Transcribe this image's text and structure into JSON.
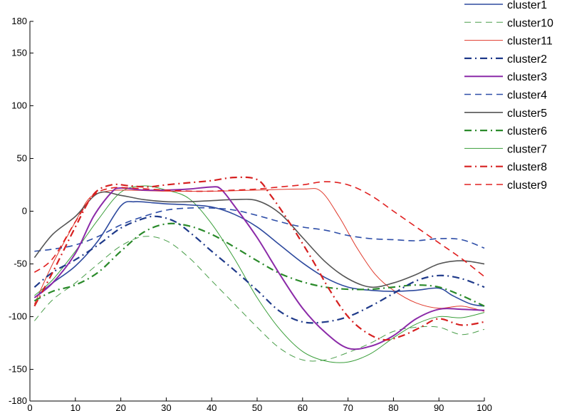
{
  "chart_data": {
    "type": "line",
    "title": "",
    "xlabel": "",
    "ylabel": "",
    "xlim": [
      0,
      100
    ],
    "ylim": [
      -180,
      180
    ],
    "x_ticks": [
      0,
      10,
      20,
      30,
      40,
      50,
      60,
      70,
      80,
      90,
      100
    ],
    "y_ticks": [
      180,
      150,
      100,
      50,
      0,
      -50,
      -100,
      -150,
      -180
    ],
    "grid": false,
    "legend_position": "top-right",
    "series": [
      {
        "name": "cluster1",
        "color": "#2e4a9e",
        "style": "solid",
        "width": 1.6,
        "x": [
          1,
          5,
          10,
          15,
          20,
          23,
          27,
          30,
          35,
          40,
          45,
          50,
          55,
          60,
          65,
          70,
          75,
          80,
          85,
          90,
          93,
          97,
          100
        ],
        "y": [
          -82,
          -68,
          -52,
          -28,
          5,
          9,
          8,
          7,
          6,
          4,
          -3,
          -15,
          -32,
          -49,
          -63,
          -72,
          -75,
          -76,
          -75,
          -73,
          -80,
          -88,
          -90
        ]
      },
      {
        "name": "cluster10",
        "color": "#4a9e4a",
        "style": "dashed",
        "width": 1.0,
        "x": [
          1,
          5,
          10,
          15,
          20,
          25,
          30,
          35,
          40,
          45,
          50,
          55,
          60,
          65,
          70,
          75,
          80,
          85,
          90,
          95,
          100
        ],
        "y": [
          -104,
          -84,
          -68,
          -50,
          -33,
          -24,
          -28,
          -44,
          -66,
          -88,
          -110,
          -130,
          -141,
          -141,
          -134,
          -125,
          -114,
          -110,
          -110,
          -117,
          -112
        ]
      },
      {
        "name": "cluster11",
        "color": "#e0392b",
        "style": "solid",
        "width": 1.0,
        "x": [
          1,
          5,
          10,
          13,
          16,
          20,
          30,
          40,
          50,
          60,
          64,
          68,
          72,
          76,
          80,
          85,
          90,
          95,
          100
        ],
        "y": [
          -88,
          -50,
          -10,
          12,
          18,
          20,
          19,
          19,
          20,
          21,
          19,
          -5,
          -35,
          -60,
          -75,
          -87,
          -92,
          -90,
          -95
        ]
      },
      {
        "name": "cluster2",
        "color": "#1f3a8a",
        "style": "dashdot",
        "width": 2.2,
        "x": [
          1,
          5,
          10,
          15,
          20,
          25,
          28,
          32,
          36,
          40,
          45,
          50,
          55,
          60,
          65,
          70,
          75,
          80,
          85,
          90,
          95,
          100
        ],
        "y": [
          -72,
          -58,
          -46,
          -32,
          -16,
          -7,
          -5,
          -10,
          -23,
          -38,
          -56,
          -75,
          -95,
          -105,
          -105,
          -100,
          -90,
          -78,
          -66,
          -61,
          -64,
          -72
        ]
      },
      {
        "name": "cluster3",
        "color": "#8b2aa8",
        "style": "solid",
        "width": 2.0,
        "x": [
          1,
          5,
          10,
          14,
          18,
          20,
          25,
          30,
          35,
          40,
          42,
          45,
          50,
          55,
          60,
          65,
          70,
          75,
          80,
          85,
          90,
          95,
          100
        ],
        "y": [
          -82,
          -68,
          -40,
          -5,
          18,
          22,
          20,
          20,
          21,
          23,
          21,
          5,
          -25,
          -60,
          -92,
          -115,
          -130,
          -128,
          -118,
          -102,
          -93,
          -93,
          -94
        ]
      },
      {
        "name": "cluster4",
        "color": "#2e4ea8",
        "style": "dashed",
        "width": 1.6,
        "x": [
          1,
          5,
          10,
          15,
          20,
          25,
          30,
          35,
          40,
          45,
          50,
          55,
          60,
          65,
          70,
          75,
          80,
          85,
          90,
          95,
          100
        ],
        "y": [
          -38,
          -36,
          -32,
          -24,
          -13,
          -5,
          1,
          3,
          3,
          1,
          -4,
          -10,
          -15,
          -18,
          -23,
          -26,
          -27,
          -28,
          -26,
          -27,
          -35
        ]
      },
      {
        "name": "cluster5",
        "color": "#555555",
        "style": "solid",
        "width": 1.6,
        "x": [
          1,
          5,
          10,
          15,
          20,
          25,
          30,
          35,
          40,
          45,
          50,
          55,
          60,
          65,
          70,
          75,
          80,
          85,
          90,
          95,
          100
        ],
        "y": [
          -44,
          -22,
          -5,
          17,
          15,
          11,
          9,
          9,
          10,
          11,
          10,
          -2,
          -25,
          -48,
          -64,
          -72,
          -68,
          -60,
          -50,
          -47,
          -50
        ]
      },
      {
        "name": "cluster6",
        "color": "#2a8a2a",
        "style": "dashdot",
        "width": 2.2,
        "x": [
          1,
          5,
          10,
          15,
          20,
          25,
          30,
          35,
          40,
          45,
          50,
          55,
          60,
          65,
          70,
          75,
          80,
          85,
          90,
          95,
          100
        ],
        "y": [
          -85,
          -76,
          -70,
          -58,
          -38,
          -20,
          -12,
          -14,
          -22,
          -34,
          -47,
          -59,
          -67,
          -72,
          -74,
          -74,
          -72,
          -70,
          -72,
          -80,
          -90
        ]
      },
      {
        "name": "cluster7",
        "color": "#3a9e3a",
        "style": "solid",
        "width": 1.0,
        "x": [
          1,
          5,
          10,
          15,
          20,
          25,
          30,
          35,
          40,
          45,
          50,
          55,
          60,
          65,
          70,
          75,
          80,
          85,
          90,
          95,
          100
        ],
        "y": [
          -80,
          -65,
          -38,
          -8,
          18,
          24,
          20,
          12,
          -12,
          -45,
          -82,
          -112,
          -133,
          -142,
          -143,
          -135,
          -120,
          -107,
          -100,
          -101,
          -96
        ]
      },
      {
        "name": "cluster8",
        "color": "#d62020",
        "style": "dashdot",
        "width": 2.2,
        "x": [
          1,
          5,
          10,
          14,
          18,
          22,
          26,
          30,
          35,
          40,
          45,
          50,
          53,
          57,
          62,
          66,
          70,
          74,
          78,
          82,
          86,
          90,
          95,
          100
        ],
        "y": [
          -90,
          -58,
          -15,
          16,
          25,
          24,
          23,
          25,
          27,
          29,
          32,
          30,
          15,
          -10,
          -45,
          -75,
          -100,
          -115,
          -122,
          -118,
          -110,
          -102,
          -108,
          -105
        ]
      },
      {
        "name": "cluster9",
        "color": "#e02020",
        "style": "dashed",
        "width": 1.6,
        "x": [
          1,
          5,
          10,
          14,
          18,
          22,
          26,
          30,
          35,
          40,
          45,
          50,
          55,
          60,
          65,
          70,
          75,
          80,
          85,
          90,
          95,
          100
        ],
        "y": [
          -58,
          -45,
          -10,
          15,
          22,
          22,
          21,
          20,
          19,
          19,
          20,
          21,
          23,
          25,
          28,
          25,
          15,
          0,
          -15,
          -30,
          -45,
          -62
        ]
      }
    ]
  }
}
